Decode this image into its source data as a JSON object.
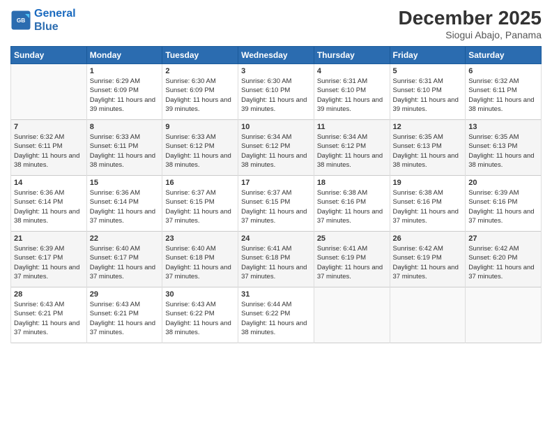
{
  "header": {
    "logo_line1": "General",
    "logo_line2": "Blue",
    "month": "December 2025",
    "location": "Siogui Abajo, Panama"
  },
  "days_of_week": [
    "Sunday",
    "Monday",
    "Tuesday",
    "Wednesday",
    "Thursday",
    "Friday",
    "Saturday"
  ],
  "weeks": [
    [
      {
        "num": "",
        "sunrise": "",
        "sunset": "",
        "daylight": "",
        "empty": true
      },
      {
        "num": "1",
        "sunrise": "Sunrise: 6:29 AM",
        "sunset": "Sunset: 6:09 PM",
        "daylight": "Daylight: 11 hours and 39 minutes."
      },
      {
        "num": "2",
        "sunrise": "Sunrise: 6:30 AM",
        "sunset": "Sunset: 6:09 PM",
        "daylight": "Daylight: 11 hours and 39 minutes."
      },
      {
        "num": "3",
        "sunrise": "Sunrise: 6:30 AM",
        "sunset": "Sunset: 6:10 PM",
        "daylight": "Daylight: 11 hours and 39 minutes."
      },
      {
        "num": "4",
        "sunrise": "Sunrise: 6:31 AM",
        "sunset": "Sunset: 6:10 PM",
        "daylight": "Daylight: 11 hours and 39 minutes."
      },
      {
        "num": "5",
        "sunrise": "Sunrise: 6:31 AM",
        "sunset": "Sunset: 6:10 PM",
        "daylight": "Daylight: 11 hours and 39 minutes."
      },
      {
        "num": "6",
        "sunrise": "Sunrise: 6:32 AM",
        "sunset": "Sunset: 6:11 PM",
        "daylight": "Daylight: 11 hours and 38 minutes."
      }
    ],
    [
      {
        "num": "7",
        "sunrise": "Sunrise: 6:32 AM",
        "sunset": "Sunset: 6:11 PM",
        "daylight": "Daylight: 11 hours and 38 minutes."
      },
      {
        "num": "8",
        "sunrise": "Sunrise: 6:33 AM",
        "sunset": "Sunset: 6:11 PM",
        "daylight": "Daylight: 11 hours and 38 minutes."
      },
      {
        "num": "9",
        "sunrise": "Sunrise: 6:33 AM",
        "sunset": "Sunset: 6:12 PM",
        "daylight": "Daylight: 11 hours and 38 minutes."
      },
      {
        "num": "10",
        "sunrise": "Sunrise: 6:34 AM",
        "sunset": "Sunset: 6:12 PM",
        "daylight": "Daylight: 11 hours and 38 minutes."
      },
      {
        "num": "11",
        "sunrise": "Sunrise: 6:34 AM",
        "sunset": "Sunset: 6:12 PM",
        "daylight": "Daylight: 11 hours and 38 minutes."
      },
      {
        "num": "12",
        "sunrise": "Sunrise: 6:35 AM",
        "sunset": "Sunset: 6:13 PM",
        "daylight": "Daylight: 11 hours and 38 minutes."
      },
      {
        "num": "13",
        "sunrise": "Sunrise: 6:35 AM",
        "sunset": "Sunset: 6:13 PM",
        "daylight": "Daylight: 11 hours and 38 minutes."
      }
    ],
    [
      {
        "num": "14",
        "sunrise": "Sunrise: 6:36 AM",
        "sunset": "Sunset: 6:14 PM",
        "daylight": "Daylight: 11 hours and 38 minutes."
      },
      {
        "num": "15",
        "sunrise": "Sunrise: 6:36 AM",
        "sunset": "Sunset: 6:14 PM",
        "daylight": "Daylight: 11 hours and 37 minutes."
      },
      {
        "num": "16",
        "sunrise": "Sunrise: 6:37 AM",
        "sunset": "Sunset: 6:15 PM",
        "daylight": "Daylight: 11 hours and 37 minutes."
      },
      {
        "num": "17",
        "sunrise": "Sunrise: 6:37 AM",
        "sunset": "Sunset: 6:15 PM",
        "daylight": "Daylight: 11 hours and 37 minutes."
      },
      {
        "num": "18",
        "sunrise": "Sunrise: 6:38 AM",
        "sunset": "Sunset: 6:16 PM",
        "daylight": "Daylight: 11 hours and 37 minutes."
      },
      {
        "num": "19",
        "sunrise": "Sunrise: 6:38 AM",
        "sunset": "Sunset: 6:16 PM",
        "daylight": "Daylight: 11 hours and 37 minutes."
      },
      {
        "num": "20",
        "sunrise": "Sunrise: 6:39 AM",
        "sunset": "Sunset: 6:16 PM",
        "daylight": "Daylight: 11 hours and 37 minutes."
      }
    ],
    [
      {
        "num": "21",
        "sunrise": "Sunrise: 6:39 AM",
        "sunset": "Sunset: 6:17 PM",
        "daylight": "Daylight: 11 hours and 37 minutes."
      },
      {
        "num": "22",
        "sunrise": "Sunrise: 6:40 AM",
        "sunset": "Sunset: 6:17 PM",
        "daylight": "Daylight: 11 hours and 37 minutes."
      },
      {
        "num": "23",
        "sunrise": "Sunrise: 6:40 AM",
        "sunset": "Sunset: 6:18 PM",
        "daylight": "Daylight: 11 hours and 37 minutes."
      },
      {
        "num": "24",
        "sunrise": "Sunrise: 6:41 AM",
        "sunset": "Sunset: 6:18 PM",
        "daylight": "Daylight: 11 hours and 37 minutes."
      },
      {
        "num": "25",
        "sunrise": "Sunrise: 6:41 AM",
        "sunset": "Sunset: 6:19 PM",
        "daylight": "Daylight: 11 hours and 37 minutes."
      },
      {
        "num": "26",
        "sunrise": "Sunrise: 6:42 AM",
        "sunset": "Sunset: 6:19 PM",
        "daylight": "Daylight: 11 hours and 37 minutes."
      },
      {
        "num": "27",
        "sunrise": "Sunrise: 6:42 AM",
        "sunset": "Sunset: 6:20 PM",
        "daylight": "Daylight: 11 hours and 37 minutes."
      }
    ],
    [
      {
        "num": "28",
        "sunrise": "Sunrise: 6:43 AM",
        "sunset": "Sunset: 6:21 PM",
        "daylight": "Daylight: 11 hours and 37 minutes."
      },
      {
        "num": "29",
        "sunrise": "Sunrise: 6:43 AM",
        "sunset": "Sunset: 6:21 PM",
        "daylight": "Daylight: 11 hours and 37 minutes."
      },
      {
        "num": "30",
        "sunrise": "Sunrise: 6:43 AM",
        "sunset": "Sunset: 6:22 PM",
        "daylight": "Daylight: 11 hours and 38 minutes."
      },
      {
        "num": "31",
        "sunrise": "Sunrise: 6:44 AM",
        "sunset": "Sunset: 6:22 PM",
        "daylight": "Daylight: 11 hours and 38 minutes."
      },
      {
        "num": "",
        "sunrise": "",
        "sunset": "",
        "daylight": "",
        "empty": true
      },
      {
        "num": "",
        "sunrise": "",
        "sunset": "",
        "daylight": "",
        "empty": true
      },
      {
        "num": "",
        "sunrise": "",
        "sunset": "",
        "daylight": "",
        "empty": true
      }
    ]
  ]
}
